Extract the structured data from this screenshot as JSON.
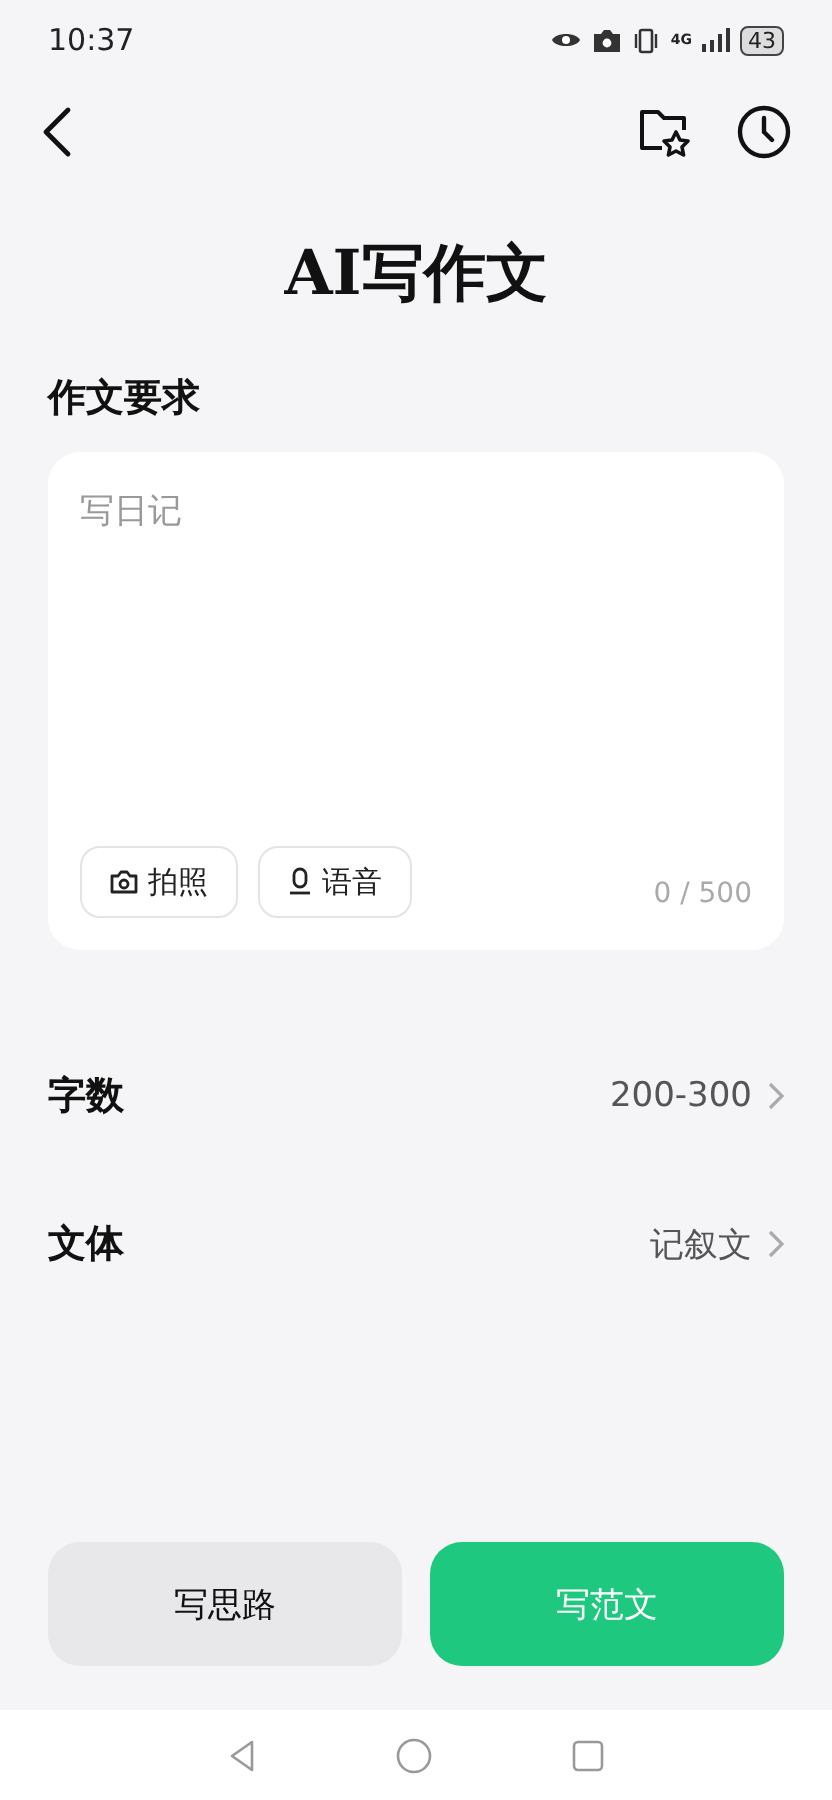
{
  "status_bar": {
    "time": "10:37",
    "network": "4G",
    "battery": "43"
  },
  "title": "AI写作文",
  "requirement": {
    "label": "作文要求",
    "placeholder": "写日记",
    "counter": "0 / 500",
    "tools": [
      {
        "kind": "camera",
        "label": "拍照"
      },
      {
        "kind": "mic",
        "label": "语音"
      }
    ]
  },
  "settings": [
    {
      "label": "字数",
      "value": "200-300"
    },
    {
      "label": "文体",
      "value": "记叙文"
    }
  ],
  "actions": [
    {
      "label": "写思路",
      "primary": false
    },
    {
      "label": "写范文",
      "primary": true
    }
  ]
}
